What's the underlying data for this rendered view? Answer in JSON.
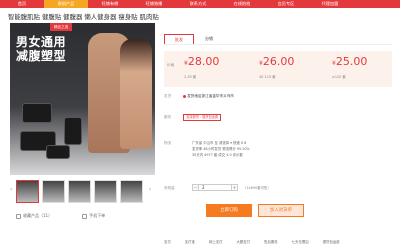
{
  "nav": {
    "items": [
      "首页",
      "原创产品",
      "旺铺有哪",
      "旺铺独播",
      "联系方式",
      "在线拍档",
      "会员专区",
      "代理加盟"
    ],
    "active_index": 1
  },
  "product": {
    "title": "智能腹肌贴 健腹贴 健腹器 懒人健身器 瘦身贴 肌肉贴",
    "promo_tag": "精品之选",
    "slogan_line1": "男女通用",
    "slogan_line2": "减腹塑型"
  },
  "gallery": {
    "prev": "‹",
    "next": "›",
    "thumb_count": 5
  },
  "actions": {
    "favorite": "收藏产品（11）",
    "mobile": "手机下单"
  },
  "tabs": [
    "批发",
    "分销"
  ],
  "pricing": {
    "label": "价格",
    "tiers": [
      {
        "price": "28.00",
        "qty": "2-39 套"
      },
      {
        "price": "26.00",
        "qty": "40-119 套"
      },
      {
        "price": "25.00",
        "qty": "≥120 套"
      }
    ],
    "currency": "¥"
  },
  "origin": {
    "label": "发货",
    "value": "发货地区浙江省金华市义乌市"
  },
  "service": {
    "label": "服务",
    "tag": "支持退货 - 退货包运费"
  },
  "shipping": {
    "label": "物流",
    "line1": "广东省 中山市  至  请选择  ▾    快递 ¥ 8",
    "line2": "发货率 48小时发货    物流得分 95.20%",
    "line3": "30天内 4977 套  成交   5.0 评价数"
  },
  "quantity": {
    "label": "采购量",
    "value": "2",
    "minus": "－",
    "plus": "＋",
    "stock": "（14690套可售）"
  },
  "buttons": {
    "buy": "立即订购",
    "cart": "加入进货单"
  },
  "bottom": {
    "items": [
      "支付",
      "支付宝",
      "网上支付",
      "大额支付",
      "售后服务",
      "七天无理由",
      "退货包运费"
    ]
  },
  "colors": {
    "brand": "#e4393c",
    "accent": "#f57a20",
    "price_bg": "#fdf1ec"
  }
}
